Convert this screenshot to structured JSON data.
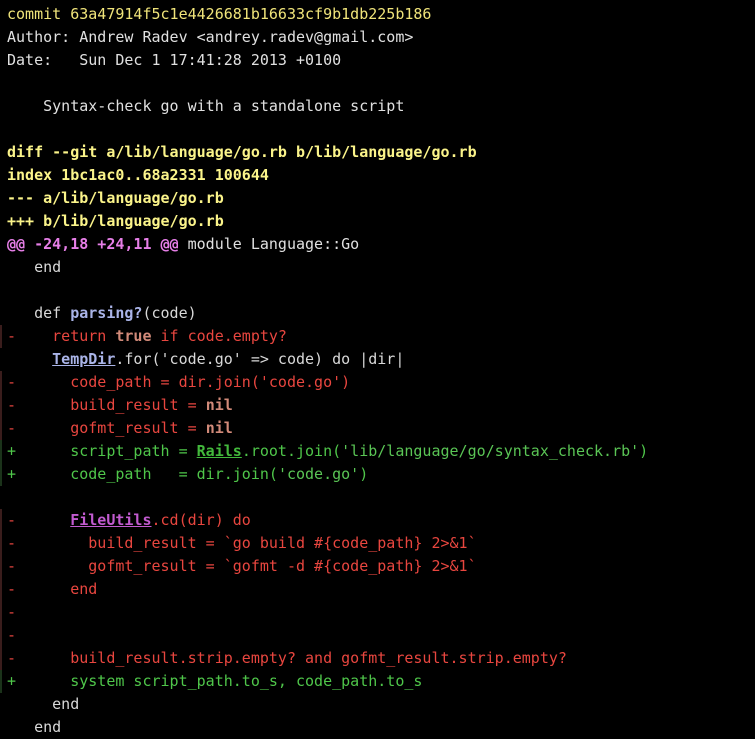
{
  "commit": {
    "line": "commit 63a47914f5c1e4426681b16633cf9b1db225b186",
    "author": "Author: Andrew Radev <andrey.radev@gmail.com>",
    "date": "Date:   Sun Dec 1 17:41:28 2013 +0100",
    "message": "    Syntax-check go with a standalone script"
  },
  "diff_header": {
    "diff_line": "diff --git a/lib/language/go.rb b/lib/language/go.rb",
    "index_line": "index 1bc1ac0..68a2331 100644",
    "minus_file": "--- a/lib/language/go.rb",
    "plus_file": "+++ b/lib/language/go.rb",
    "hunk_range": "@@ -24,18 +24,11 @@",
    "hunk_context": " module Language::Go"
  },
  "lines": {
    "l01": "   end",
    "l02": "",
    "l03_a": "   def ",
    "l03_b": "parsing?",
    "l03_c": "(code)",
    "l04_marker": "-",
    "l04_a": "     ",
    "l04_b": "return",
    "l04_c": " ",
    "l04_d": "true",
    "l04_e": " ",
    "l04_f": "if",
    "l04_g": " code.empty?",
    "l05_a": "     ",
    "l05_b": "TempDir",
    "l05_c": ".for('code.go' => code) do |dir|",
    "l06_marker": "-",
    "l06_a": "       code_path = dir.join(",
    "l06_b": "'code.go'",
    "l06_c": ")",
    "l07_marker": "-",
    "l07_a": "       build_result = ",
    "l07_b": "nil",
    "l08_marker": "-",
    "l08_a": "       gofmt_result = ",
    "l08_b": "nil",
    "l09_marker": "+",
    "l09_a": "       script_path = ",
    "l09_b": "Rails",
    "l09_c": ".root.join(",
    "l09_d": "'lib/language/go/syntax_check.rb'",
    "l09_e": ")",
    "l10_marker": "+",
    "l10_a": "       code_path   = dir.join(",
    "l10_b": "'code.go'",
    "l10_c": ")",
    "l11": "",
    "l12_marker": "-",
    "l12_a": "       ",
    "l12_b": "FileUtils",
    "l12_c": ".cd(dir) ",
    "l12_d": "do",
    "l13_marker": "-",
    "l13_a": "         build_result = `go build #{code_path} 2>&1`",
    "l14_marker": "-",
    "l14_a": "         gofmt_result = `gofmt -d #{code_path} 2>&1`",
    "l15_marker": "-",
    "l15_a": "       end",
    "l16_marker": "-",
    "l17_marker": "-",
    "l18_marker": "-",
    "l18_a": "       build_result.strip.empty? ",
    "l18_b": "and",
    "l18_c": " gofmt_result.strip.empty?",
    "l19_marker": "+",
    "l19_a": "       system script_path.to_s, code_path.to_s",
    "l20": "     end",
    "l21": "   end"
  },
  "colors": {
    "background": "#000000",
    "deleted": "#e8463f",
    "added": "#4fc64a",
    "header_yellow": "#fbf48a",
    "hunk_magenta": "#e77fe8"
  }
}
